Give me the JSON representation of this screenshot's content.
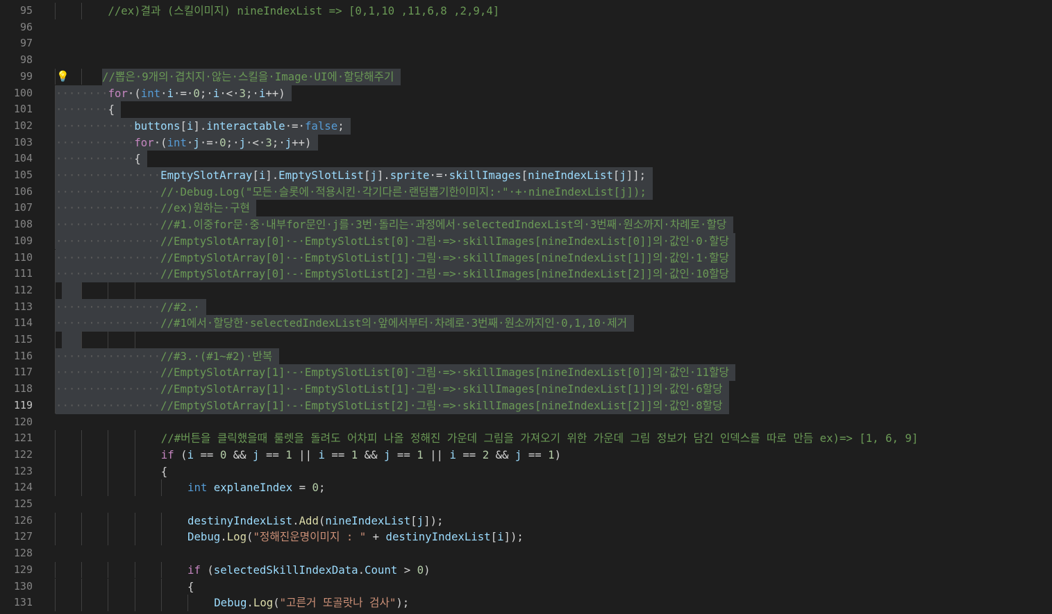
{
  "editor": {
    "language": "csharp",
    "theme_colors": {
      "background": "#1e1e1e",
      "selection": "#3a3d41",
      "line_number": "#858585",
      "keyword": "#569cd6",
      "control_keyword": "#c586c0",
      "variable": "#9cdcfe",
      "method": "#dcdcaa",
      "string": "#ce9178",
      "number": "#b5cea8",
      "comment": "#6a9955"
    },
    "selection_range": [
      99,
      119
    ],
    "cursor_line": 119,
    "lightbulb_line": 99,
    "lines": [
      {
        "num": "95",
        "indent": 2,
        "tokens": [
          {
            "t": "c",
            "v": "//ex)결과 (스킬이미지) nineIndexList => [0,1,10 ,11,6,8 ,2,9,4]"
          }
        ]
      },
      {
        "num": "96",
        "indent": 0,
        "tokens": []
      },
      {
        "num": "97",
        "indent": 0,
        "tokens": []
      },
      {
        "num": "98",
        "indent": 0,
        "tokens": []
      },
      {
        "num": "99",
        "indent": 2,
        "tokens": [
          {
            "t": "c",
            "v": "//뽑은·9개의·겹치지·않는·스킬을·Image·UI에·할당해주기"
          }
        ]
      },
      {
        "num": "100",
        "indent": 2,
        "tokens": [
          {
            "t": "kc",
            "v": "for"
          },
          {
            "t": "p",
            "v": "·("
          },
          {
            "t": "k",
            "v": "int"
          },
          {
            "t": "p",
            "v": "·"
          },
          {
            "t": "v",
            "v": "i"
          },
          {
            "t": "p",
            "v": "·=·"
          },
          {
            "t": "n",
            "v": "0"
          },
          {
            "t": "p",
            "v": ";·"
          },
          {
            "t": "v",
            "v": "i"
          },
          {
            "t": "p",
            "v": "·<·"
          },
          {
            "t": "n",
            "v": "3"
          },
          {
            "t": "p",
            "v": ";·"
          },
          {
            "t": "v",
            "v": "i"
          },
          {
            "t": "p",
            "v": "++)"
          }
        ]
      },
      {
        "num": "101",
        "indent": 2,
        "tokens": [
          {
            "t": "p",
            "v": "{"
          }
        ]
      },
      {
        "num": "102",
        "indent": 3,
        "tokens": [
          {
            "t": "v",
            "v": "buttons"
          },
          {
            "t": "p",
            "v": "["
          },
          {
            "t": "v",
            "v": "i"
          },
          {
            "t": "p",
            "v": "]."
          },
          {
            "t": "v",
            "v": "interactable"
          },
          {
            "t": "p",
            "v": "·=·"
          },
          {
            "t": "k",
            "v": "false"
          },
          {
            "t": "p",
            "v": ";"
          }
        ]
      },
      {
        "num": "103",
        "indent": 3,
        "tokens": [
          {
            "t": "kc",
            "v": "for"
          },
          {
            "t": "p",
            "v": "·("
          },
          {
            "t": "k",
            "v": "int"
          },
          {
            "t": "p",
            "v": "·"
          },
          {
            "t": "v",
            "v": "j"
          },
          {
            "t": "p",
            "v": "·=·"
          },
          {
            "t": "n",
            "v": "0"
          },
          {
            "t": "p",
            "v": ";·"
          },
          {
            "t": "v",
            "v": "j"
          },
          {
            "t": "p",
            "v": "·<·"
          },
          {
            "t": "n",
            "v": "3"
          },
          {
            "t": "p",
            "v": ";·"
          },
          {
            "t": "v",
            "v": "j"
          },
          {
            "t": "p",
            "v": "++)"
          }
        ]
      },
      {
        "num": "104",
        "indent": 3,
        "tokens": [
          {
            "t": "p",
            "v": "{"
          }
        ]
      },
      {
        "num": "105",
        "indent": 4,
        "tokens": [
          {
            "t": "v",
            "v": "EmptySlotArray"
          },
          {
            "t": "p",
            "v": "["
          },
          {
            "t": "v",
            "v": "i"
          },
          {
            "t": "p",
            "v": "]."
          },
          {
            "t": "v",
            "v": "EmptySlotList"
          },
          {
            "t": "p",
            "v": "["
          },
          {
            "t": "v",
            "v": "j"
          },
          {
            "t": "p",
            "v": "]."
          },
          {
            "t": "v",
            "v": "sprite"
          },
          {
            "t": "p",
            "v": "·=·"
          },
          {
            "t": "v",
            "v": "skillImages"
          },
          {
            "t": "p",
            "v": "["
          },
          {
            "t": "v",
            "v": "nineIndexList"
          },
          {
            "t": "p",
            "v": "["
          },
          {
            "t": "v",
            "v": "j"
          },
          {
            "t": "p",
            "v": "]];"
          }
        ]
      },
      {
        "num": "106",
        "indent": 4,
        "tokens": [
          {
            "t": "c",
            "v": "//·Debug.Log(\"모든·슬롯에·적용시킨·각기다른·랜덤뽑기한이미지:·\"·+·nineIndexList[j]);"
          }
        ]
      },
      {
        "num": "107",
        "indent": 4,
        "tokens": [
          {
            "t": "c",
            "v": "//ex)원하는·구현"
          }
        ]
      },
      {
        "num": "108",
        "indent": 4,
        "tokens": [
          {
            "t": "c",
            "v": "//#1.이중for문·중·내부for문인·j를·3번·돌리는·과정에서·selectedIndexList의·3번째·원소까지·차례로·할당"
          }
        ]
      },
      {
        "num": "109",
        "indent": 4,
        "tokens": [
          {
            "t": "c",
            "v": "//EmptySlotArray[0]·-·EmptySlotList[0]·그림·=>·skillImages[nineIndexList[0]]의·값인·0·할당"
          }
        ]
      },
      {
        "num": "110",
        "indent": 4,
        "tokens": [
          {
            "t": "c",
            "v": "//EmptySlotArray[0]·-·EmptySlotList[1]·그림·=>·skillImages[nineIndexList[1]]의·값인·1·할당"
          }
        ]
      },
      {
        "num": "111",
        "indent": 4,
        "tokens": [
          {
            "t": "c",
            "v": "//EmptySlotArray[0]·-·EmptySlotList[2]·그림·=>·skillImages[nineIndexList[2]]의·값인·10할당"
          }
        ]
      },
      {
        "num": "112",
        "indent": 0,
        "tokens": []
      },
      {
        "num": "113",
        "indent": 4,
        "tokens": [
          {
            "t": "c",
            "v": "//#2.·"
          }
        ]
      },
      {
        "num": "114",
        "indent": 4,
        "tokens": [
          {
            "t": "c",
            "v": "//#1에서·할당한·selectedIndexList의·앞에서부터·차례로·3번째·원소까지인·0,1,10·제거"
          }
        ]
      },
      {
        "num": "115",
        "indent": 0,
        "tokens": []
      },
      {
        "num": "116",
        "indent": 4,
        "tokens": [
          {
            "t": "c",
            "v": "//#3.·(#1~#2)·반복"
          }
        ]
      },
      {
        "num": "117",
        "indent": 4,
        "tokens": [
          {
            "t": "c",
            "v": "//EmptySlotArray[1]·-·EmptySlotList[0]·그림·=>·skillImages[nineIndexList[0]]의·값인·11할당"
          }
        ]
      },
      {
        "num": "118",
        "indent": 4,
        "tokens": [
          {
            "t": "c",
            "v": "//EmptySlotArray[1]·-·EmptySlotList[1]·그림·=>·skillImages[nineIndexList[1]]의·값인·6할당"
          }
        ]
      },
      {
        "num": "119",
        "indent": 4,
        "tokens": [
          {
            "t": "c",
            "v": "//EmptySlotArray[1]·-·EmptySlotList[2]·그림·=>·skillImages[nineIndexList[2]]의·값인·8할당"
          }
        ]
      },
      {
        "num": "120",
        "indent": 0,
        "tokens": []
      },
      {
        "num": "121",
        "indent": 4,
        "tokens": [
          {
            "t": "c",
            "v": "//#버튼을 클릭했을때 룰렛을 돌려도 어차피 나올 정해진 가운데 그림을 가져오기 위한 가운데 그림 정보가 담긴 인덱스를 따로 만듬 ex)=> [1, 6, 9]"
          }
        ]
      },
      {
        "num": "122",
        "indent": 4,
        "tokens": [
          {
            "t": "kc",
            "v": "if"
          },
          {
            "t": "p",
            "v": " ("
          },
          {
            "t": "v",
            "v": "i"
          },
          {
            "t": "p",
            "v": " == "
          },
          {
            "t": "n",
            "v": "0"
          },
          {
            "t": "p",
            "v": " && "
          },
          {
            "t": "v",
            "v": "j"
          },
          {
            "t": "p",
            "v": " == "
          },
          {
            "t": "n",
            "v": "1"
          },
          {
            "t": "p",
            "v": " || "
          },
          {
            "t": "v",
            "v": "i"
          },
          {
            "t": "p",
            "v": " == "
          },
          {
            "t": "n",
            "v": "1"
          },
          {
            "t": "p",
            "v": " && "
          },
          {
            "t": "v",
            "v": "j"
          },
          {
            "t": "p",
            "v": " == "
          },
          {
            "t": "n",
            "v": "1"
          },
          {
            "t": "p",
            "v": " || "
          },
          {
            "t": "v",
            "v": "i"
          },
          {
            "t": "p",
            "v": " == "
          },
          {
            "t": "n",
            "v": "2"
          },
          {
            "t": "p",
            "v": " && "
          },
          {
            "t": "v",
            "v": "j"
          },
          {
            "t": "p",
            "v": " == "
          },
          {
            "t": "n",
            "v": "1"
          },
          {
            "t": "p",
            "v": ")"
          }
        ]
      },
      {
        "num": "123",
        "indent": 4,
        "tokens": [
          {
            "t": "p",
            "v": "{"
          }
        ]
      },
      {
        "num": "124",
        "indent": 5,
        "tokens": [
          {
            "t": "k",
            "v": "int"
          },
          {
            "t": "p",
            "v": " "
          },
          {
            "t": "v",
            "v": "explaneIndex"
          },
          {
            "t": "p",
            "v": " = "
          },
          {
            "t": "n",
            "v": "0"
          },
          {
            "t": "p",
            "v": ";"
          }
        ]
      },
      {
        "num": "125",
        "indent": 0,
        "tokens": []
      },
      {
        "num": "126",
        "indent": 5,
        "tokens": [
          {
            "t": "v",
            "v": "destinyIndexList"
          },
          {
            "t": "p",
            "v": "."
          },
          {
            "t": "m",
            "v": "Add"
          },
          {
            "t": "p",
            "v": "("
          },
          {
            "t": "v",
            "v": "nineIndexList"
          },
          {
            "t": "p",
            "v": "["
          },
          {
            "t": "v",
            "v": "j"
          },
          {
            "t": "p",
            "v": "]);"
          }
        ]
      },
      {
        "num": "127",
        "indent": 5,
        "tokens": [
          {
            "t": "v",
            "v": "Debug"
          },
          {
            "t": "p",
            "v": "."
          },
          {
            "t": "m",
            "v": "Log"
          },
          {
            "t": "p",
            "v": "("
          },
          {
            "t": "s",
            "v": "\"정해진운명이미지 : \""
          },
          {
            "t": "p",
            "v": " + "
          },
          {
            "t": "v",
            "v": "destinyIndexList"
          },
          {
            "t": "p",
            "v": "["
          },
          {
            "t": "v",
            "v": "i"
          },
          {
            "t": "p",
            "v": "]);"
          }
        ]
      },
      {
        "num": "128",
        "indent": 0,
        "tokens": []
      },
      {
        "num": "129",
        "indent": 5,
        "tokens": [
          {
            "t": "kc",
            "v": "if"
          },
          {
            "t": "p",
            "v": " ("
          },
          {
            "t": "v",
            "v": "selectedSkillIndexData"
          },
          {
            "t": "p",
            "v": "."
          },
          {
            "t": "v",
            "v": "Count"
          },
          {
            "t": "p",
            "v": " > "
          },
          {
            "t": "n",
            "v": "0"
          },
          {
            "t": "p",
            "v": ")"
          }
        ]
      },
      {
        "num": "130",
        "indent": 5,
        "tokens": [
          {
            "t": "p",
            "v": "{"
          }
        ]
      },
      {
        "num": "131",
        "indent": 6,
        "tokens": [
          {
            "t": "v",
            "v": "Debug"
          },
          {
            "t": "p",
            "v": "."
          },
          {
            "t": "m",
            "v": "Log"
          },
          {
            "t": "p",
            "v": "("
          },
          {
            "t": "s",
            "v": "\"고른거 또골랏나 검사\""
          },
          {
            "t": "p",
            "v": ");"
          }
        ]
      }
    ]
  }
}
